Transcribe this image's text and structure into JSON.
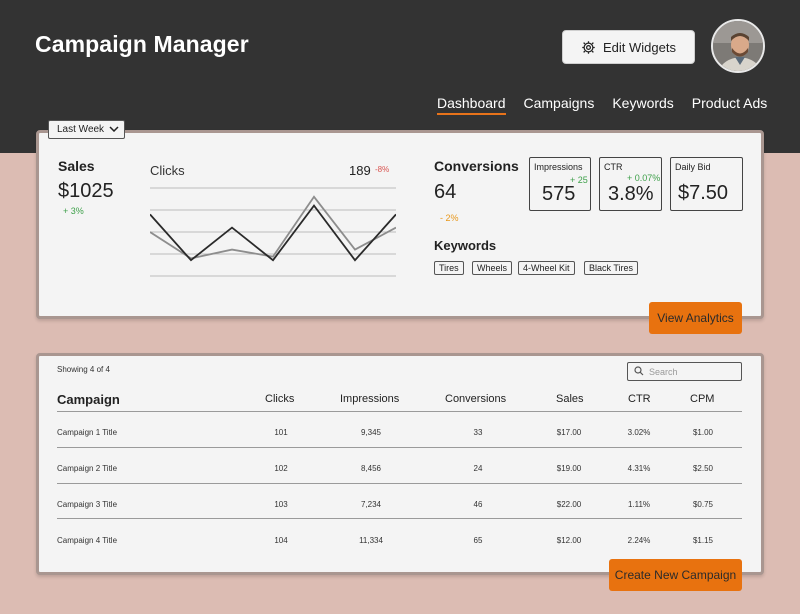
{
  "header": {
    "title": "Campaign Manager",
    "edit_widgets": "Edit Widgets",
    "nav": [
      "Dashboard",
      "Campaigns",
      "Keywords",
      "Product Ads"
    ]
  },
  "colors": {
    "accent": "#e8720f",
    "header_bg": "#333333",
    "page_bg": "#dcbcb3",
    "positive": "#3ea04a",
    "negative": "#d9534f"
  },
  "filter": {
    "period": "Last Week"
  },
  "summary": {
    "sales": {
      "label": "Sales",
      "value": "$1025",
      "delta": "+ 3%"
    },
    "clicks": {
      "label": "Clicks",
      "value": "189",
      "delta": "-8%"
    },
    "conversions": {
      "label": "Conversions",
      "value": "64",
      "delta": "- 2%"
    },
    "impressions": {
      "label": "Impressions",
      "value": "575",
      "delta": "+ 25"
    },
    "ctr": {
      "label": "CTR",
      "value": "3.8%",
      "delta": "+ 0.07%"
    },
    "daily_bid": {
      "label": "Daily Bid",
      "value": "$7.50"
    },
    "keywords_label": "Keywords",
    "keywords": [
      "Tires",
      "Wheels",
      "4-Wheel Kit",
      "Black Tires"
    ],
    "view_analytics": "View Analytics"
  },
  "chart_data": {
    "type": "line",
    "title": "Clicks",
    "series": [
      {
        "values": [
          5,
          2,
          3,
          2.2,
          9,
          3,
          5.5
        ]
      },
      {
        "values": [
          7,
          1.8,
          5.5,
          1.8,
          8,
          1.8,
          7
        ]
      }
    ]
  },
  "table": {
    "showing": "Showing 4 of 4",
    "search_placeholder": "Search",
    "columns": [
      "Campaign",
      "Clicks",
      "Impressions",
      "Conversions",
      "Sales",
      "CTR",
      "CPM"
    ],
    "rows": [
      [
        "Campaign 1 Title",
        "101",
        "9,345",
        "33",
        "$17.00",
        "3.02%",
        "$1.00"
      ],
      [
        "Campaign 2 Title",
        "102",
        "8,456",
        "24",
        "$19.00",
        "4.31%",
        "$2.50"
      ],
      [
        "Campaign 3 Title",
        "103",
        "7,234",
        "46",
        "$22.00",
        "1.11%",
        "$0.75"
      ],
      [
        "Campaign 4 Title",
        "104",
        "11,334",
        "65",
        "$12.00",
        "2.24%",
        "$1.15"
      ]
    ],
    "create_campaign": "Create New Campaign"
  }
}
